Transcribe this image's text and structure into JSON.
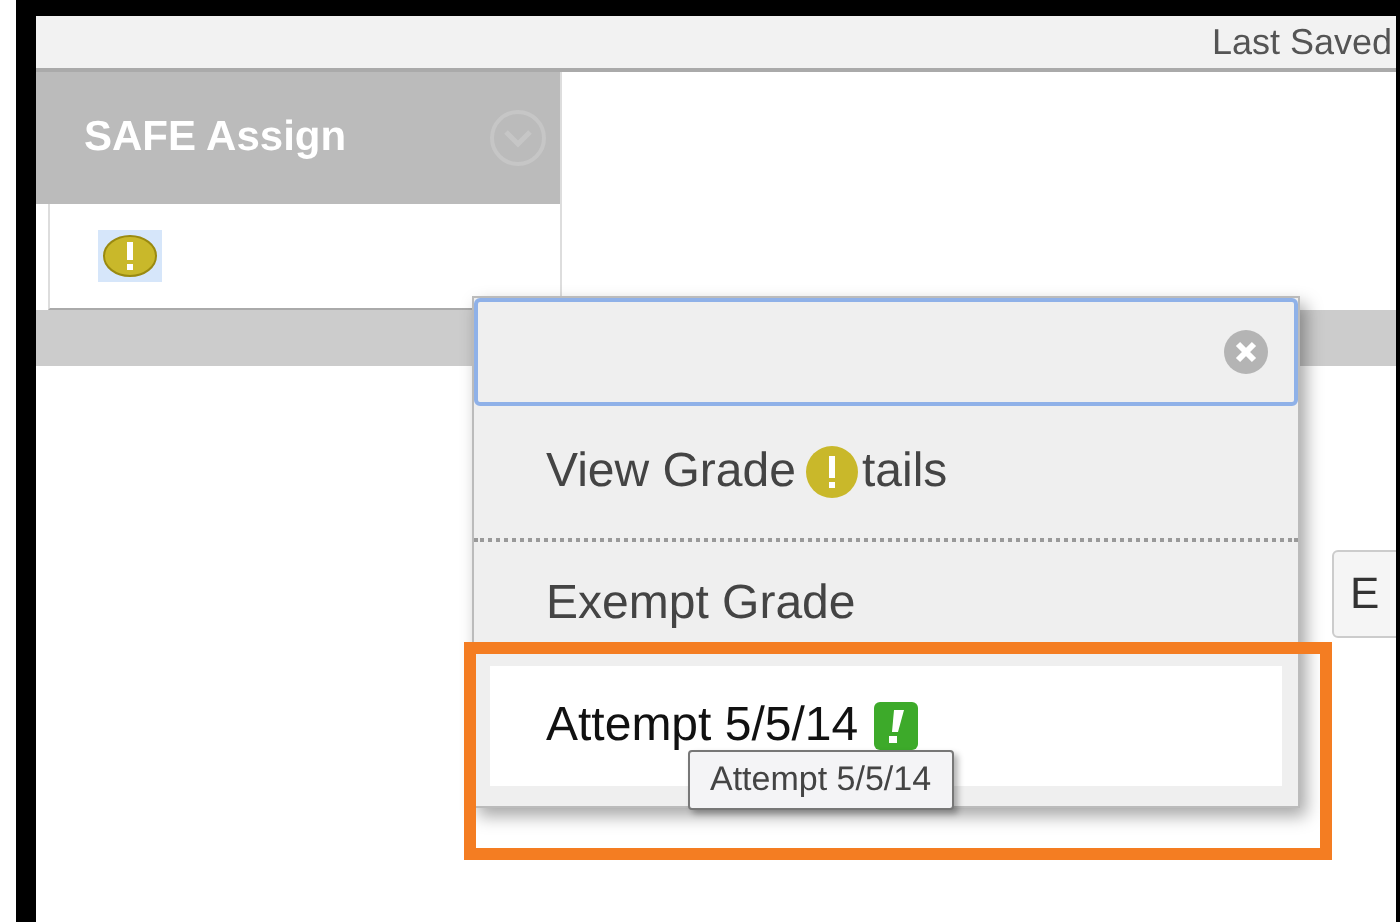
{
  "top_bar": {
    "status": "Last Saved"
  },
  "column": {
    "header": "SAFE Assign"
  },
  "side_button": {
    "label": "E"
  },
  "menu": {
    "items": [
      {
        "kind": "covered",
        "text_before": "View Grade",
        "text_after": "tails",
        "highlighted": false
      },
      {
        "kind": "plain",
        "text": "Exempt Grade",
        "highlighted": false
      },
      {
        "kind": "attempt",
        "text": "Attempt 5/5/14",
        "highlighted": true
      }
    ]
  },
  "tooltip": "Attempt 5/5/14"
}
